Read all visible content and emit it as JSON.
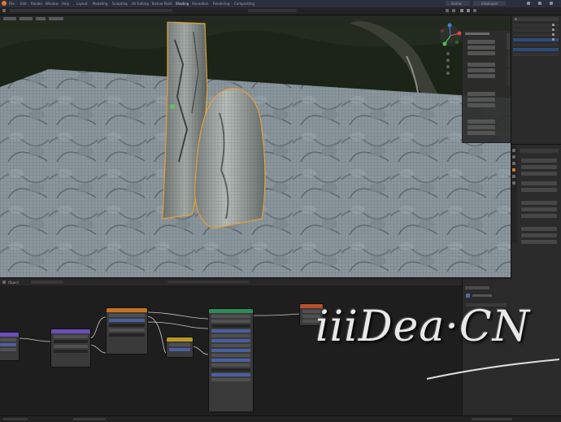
{
  "app": {
    "menu_items": [
      "File",
      "Edit",
      "Render",
      "Window",
      "Help",
      "Layout",
      "Modeling",
      "Sculpting",
      "UV Editing",
      "Texture Paint",
      "Shading",
      "Animation",
      "Rendering",
      "Compositing"
    ],
    "scene_label": "Scene",
    "view_layer_label": "ViewLayer"
  },
  "node_editor": {
    "header_label": "Object"
  },
  "watermark": {
    "text": "iiiDea·CN"
  },
  "colors": {
    "node_output": "#b5502c",
    "node_shader": "#2f8a5a",
    "node_texture": "#c3731f",
    "node_vector": "#6c4fb8",
    "node_input": "#b89720",
    "selection_outline": "#e8a33a"
  },
  "icons": [
    "search-icon",
    "camera-icon",
    "light-icon",
    "grid-icon",
    "axis-gizmo-icon",
    "hand-icon",
    "zoom-icon",
    "eye-icon",
    "wrench-icon",
    "material-icon"
  ]
}
